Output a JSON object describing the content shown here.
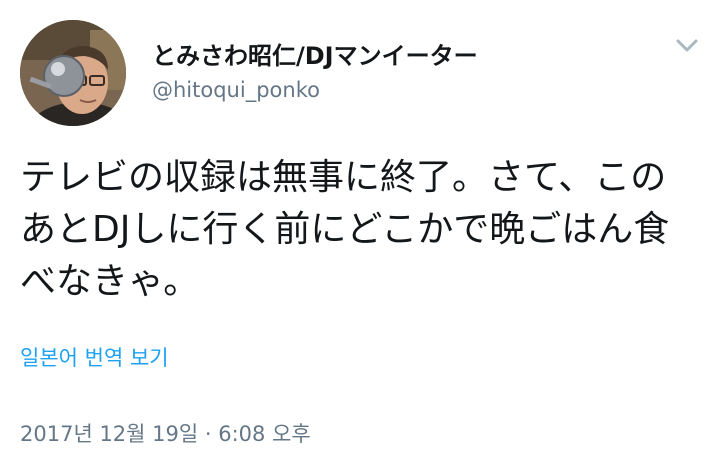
{
  "user": {
    "display_name": "とみさわ昭仁/DJマンイーター",
    "handle": "@hitoqui_ponko",
    "avatar_icon": "user-avatar-photo"
  },
  "menu": {
    "icon": "chevron-down-icon"
  },
  "tweet": {
    "text": "テレビの収録は無事に終了。さて、このあとDJしに行く前にどこかで晩ごはん食べなきゃ。",
    "translate_label": "일본어 번역 보기",
    "timestamp": "2017년 12월 19일 · 6:08 오후"
  },
  "colors": {
    "text": "#14171a",
    "secondary": "#657786",
    "link": "#1da1f2",
    "background": "#ffffff"
  }
}
